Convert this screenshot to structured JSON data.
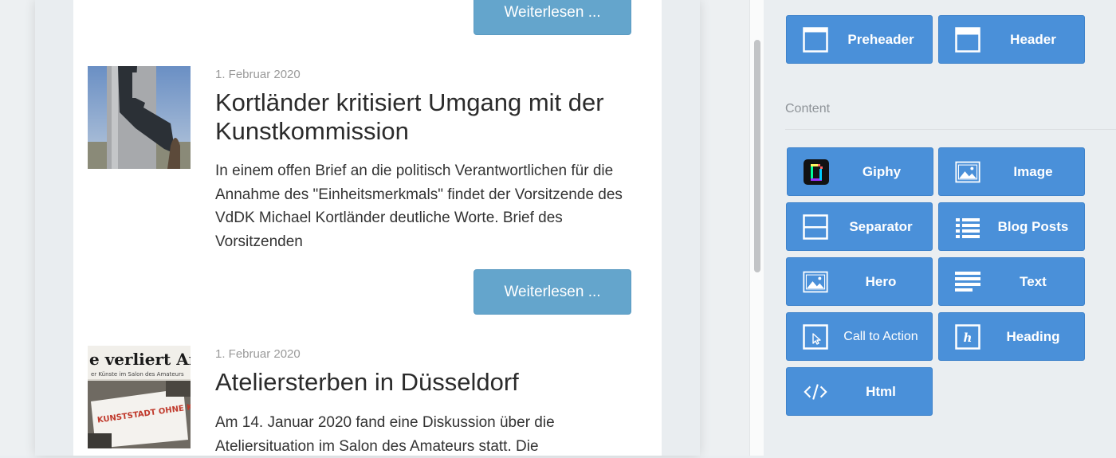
{
  "email": {
    "read_more_label": "Weiterlesen ...",
    "posts": [
      {
        "date": "1. Februar 2020",
        "title": "Kortländer kritisiert Umgang mit der Kunstkommission",
        "excerpt": "In einem offen Brief an die politisch Verantwortlichen für die Annahme des \"Einheitsmerkmals\" findet der Vorsitzende des VdDK Michael Kortländer deutliche Worte. Brief des Vorsitzenden"
      },
      {
        "date": "1. Februar 2020",
        "title": "Ateliersterben in Düsseldorf",
        "excerpt": "Am 14. Januar 2020 fand eine Diskussion über die Ateliersituation im Salon des Amateurs statt. Die",
        "image_text": {
          "headline": "e verliert Arb",
          "subline": "er Künste im Salon des Amateurs",
          "sign": "KUNSTSTADT OHNE KÜNSTLER?! NICHT MIT UNS"
        }
      }
    ]
  },
  "sidebar": {
    "layout_blocks": [
      {
        "label": "Preheader",
        "icon": "preheader-icon"
      },
      {
        "label": "Header",
        "icon": "header-icon"
      }
    ],
    "content_section_label": "Content",
    "content_blocks": [
      {
        "label": "Giphy",
        "icon": "giphy-icon"
      },
      {
        "label": "Image",
        "icon": "image-icon"
      },
      {
        "label": "Separator",
        "icon": "separator-icon"
      },
      {
        "label": "Blog Posts",
        "icon": "list-icon"
      },
      {
        "label": "Hero",
        "icon": "hero-image-icon"
      },
      {
        "label": "Text",
        "icon": "text-lines-icon"
      },
      {
        "label": "Call to Action",
        "icon": "cursor-box-icon"
      },
      {
        "label": "Heading",
        "icon": "heading-icon"
      },
      {
        "label": "Html",
        "icon": "code-icon"
      }
    ]
  },
  "colors": {
    "block_blue": "#4a90d9",
    "read_more_blue": "#64a5cc",
    "giphy_black": "#121212"
  }
}
